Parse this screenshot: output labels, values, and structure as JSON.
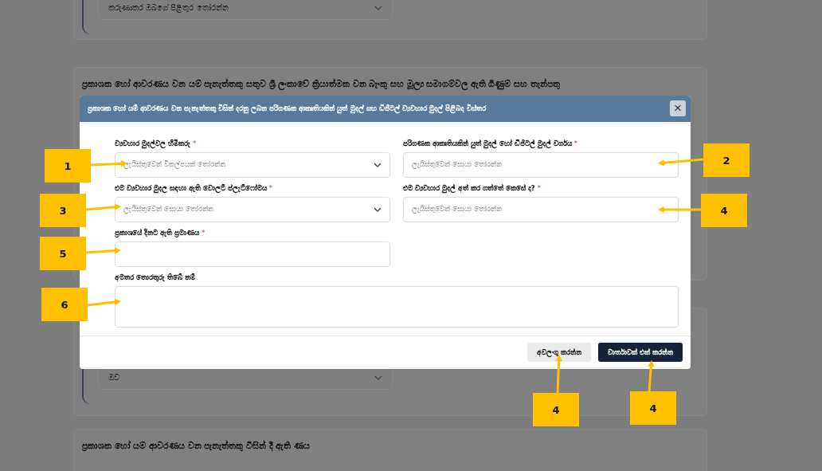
{
  "page": {
    "top_select_value": "කරුණාකර ඔබගේ පිළිතුර තෝරන්න",
    "section_title": "ප්‍රකාශක හෝ ආවරණය වන යම් පැනැත්තකු සතුව ශ්‍රී ලංකාවේ ක්‍රියාත්මක වන බැංකු සහ මූල්‍ය සමාගම්වල ඇති ගිණුම් සහ තැන්පතු",
    "answer_value": "ඔව",
    "bottom_section_title": "ප්‍රකාශක හෝ යම් ආවරණය වන පැනැත්තකු විසින් දී ඇති ණය"
  },
  "dialog": {
    "title": "ප්‍රකාශක හෝ යම් ආවරණය වන පැනැත්තකු විසින් දරනු ලබන පරිගණක ආකෘතියකින් යුත් මුදල් සහ ඩිජිටල් ව්‍යවහාර මුදල් පිළිබඳ විස්තර",
    "close": "×",
    "fields": [
      {
        "kind": "select",
        "label": "ව්‍යවහාර මුදල්වල හිමිකරු",
        "required_mark": "*",
        "placeholder": "ලැයිස්තුවෙන් විකල්පයක් තෝරන්න"
      },
      {
        "kind": "search",
        "label": "පරිගණක ආකෘතියකින් යුත් මුදල් හෝ ඩිජිටල් මුදල් වර්ගය",
        "required_mark": "*",
        "placeholder": "ලැයිස්තුවෙන් සොයා තෝරන්න"
      },
      {
        "kind": "select",
        "label": "එම ව්‍යවහාර මුදල සඳහා ඇති වොලට් ප්ලැට්ෆෝමය",
        "required_mark": "*",
        "placeholder": "ලැයිස්තුවෙන් සොයා තෝරන්න"
      },
      {
        "kind": "search",
        "label": "එම ව්‍යවහාර මුදල් අත් කර ගත්තේ කෙසේ ද?",
        "required_mark": "*",
        "placeholder": "ලැයිස්තුවෙන් සොයා තෝරන්න"
      },
      {
        "kind": "text",
        "label": "ප්‍රකාශයේ දිනට ඇති ප්‍රමාණය",
        "required_mark": "*"
      },
      {
        "kind": "textarea",
        "label": "අමතර තොරතුරු තිබේ නම්"
      }
    ],
    "buttons": [
      {
        "kind": "secondary",
        "label": "අවලංගු කරන්න"
      },
      {
        "kind": "primary",
        "label": "වාර්තාවක් එක් කරන්න"
      }
    ]
  },
  "callouts": [
    {
      "label": "1"
    },
    {
      "label": "2"
    },
    {
      "label": "3"
    },
    {
      "label": "4"
    },
    {
      "label": "5"
    },
    {
      "label": "6"
    },
    {
      "label": "4"
    },
    {
      "label": "4"
    }
  ]
}
